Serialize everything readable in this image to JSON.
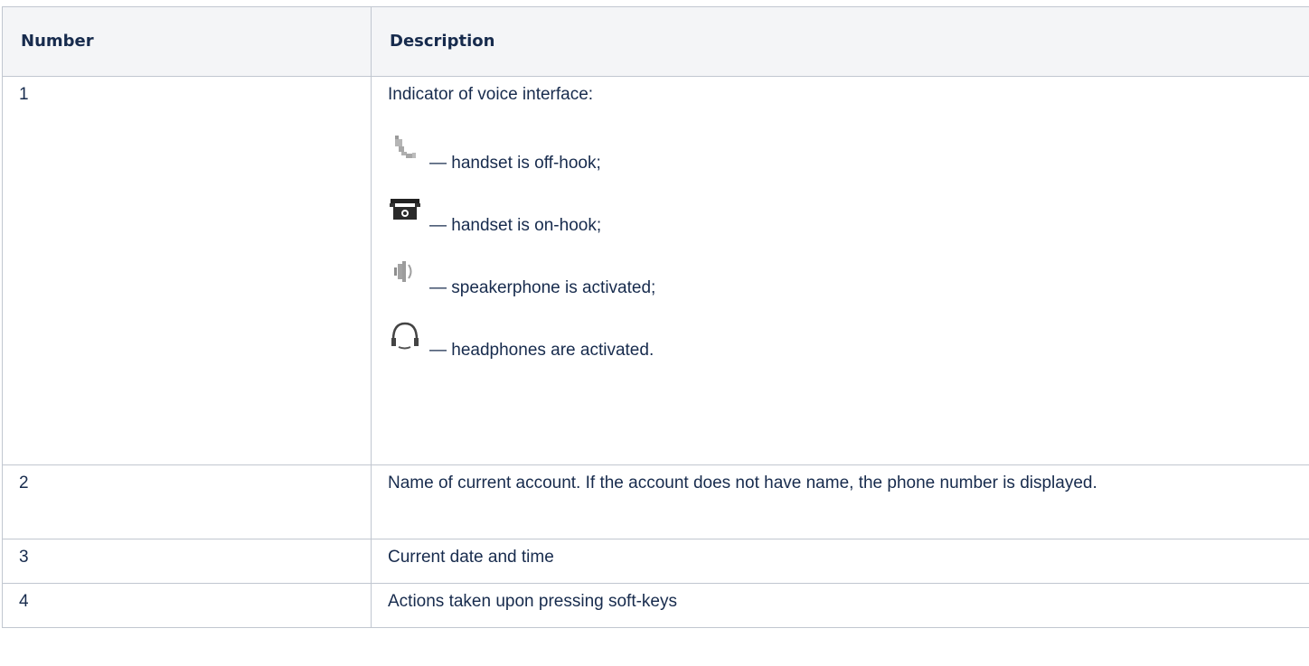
{
  "table": {
    "headers": {
      "number": "Number",
      "description": "Description"
    },
    "rows": [
      {
        "number": "1",
        "description": "Indicator of voice interface:",
        "indicators": [
          {
            "icon": "handset-off-hook-icon",
            "text": "— handset is off-hook;"
          },
          {
            "icon": "handset-on-hook-icon",
            "text": "— handset is on-hook;"
          },
          {
            "icon": "speakerphone-icon",
            "text": "— speakerphone is activated;"
          },
          {
            "icon": "headphones-icon",
            "text": "— headphones are activated."
          }
        ]
      },
      {
        "number": "2",
        "description": "Name of current account. If the account does not have name, the phone number is displayed."
      },
      {
        "number": "3",
        "description": "Current date and time"
      },
      {
        "number": "4",
        "description": "Actions taken upon pressing soft-keys"
      }
    ]
  }
}
